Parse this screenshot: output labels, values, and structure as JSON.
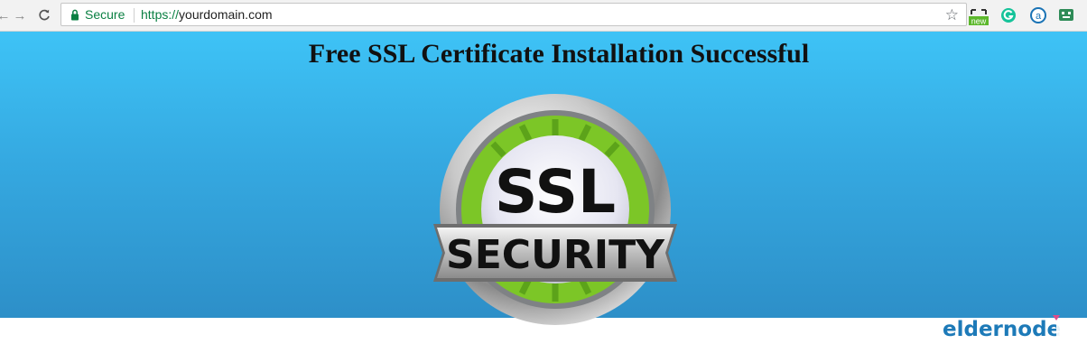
{
  "browser": {
    "security_label": "Secure",
    "url_scheme": "https://",
    "url_host": "yourdomain.com",
    "extension_new_badge": "new",
    "extension_letter": "a"
  },
  "page": {
    "headline": "Free SSL Certificate Installation Successful",
    "badge": {
      "top_text": "SSL",
      "bottom_text": "SECURITY"
    },
    "logo": {
      "text": "eldernode"
    }
  },
  "colors": {
    "secure_green": "#0b8043",
    "page_top": "#3ec3f6",
    "page_bottom": "#2d8fc8",
    "badge_green": "#7cc627",
    "logo_blue": "#1d7ab8"
  }
}
